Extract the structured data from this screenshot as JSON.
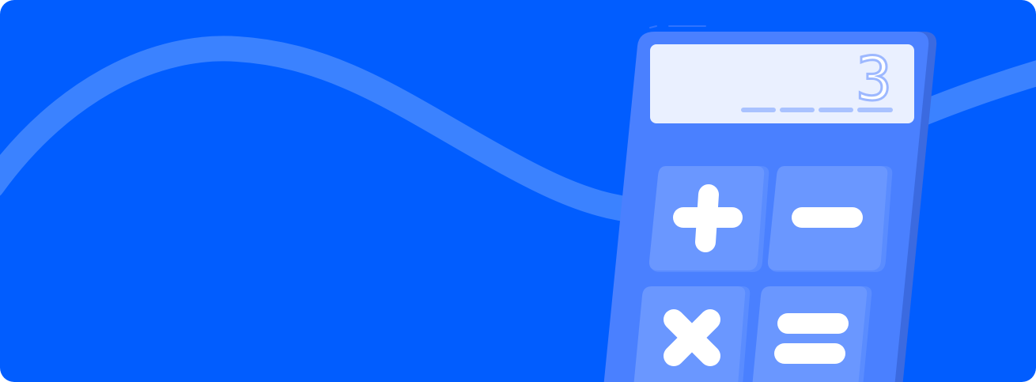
{
  "banner": {
    "background_color": "#015dff",
    "wave_color": "#3b82ff"
  },
  "calculator": {
    "display_value": "3",
    "body_color": "#4a80ff",
    "body_shadow_color": "#3b6ae0",
    "screen_color": "#eaf0ff",
    "key_color": "#6a97ff",
    "symbol_color": "#ffffff",
    "keys": [
      {
        "name": "plus-key",
        "icon": "plus-icon"
      },
      {
        "name": "minus-key",
        "icon": "minus-icon"
      },
      {
        "name": "multiply-key",
        "icon": "multiply-icon"
      },
      {
        "name": "equals-key",
        "icon": "equals-icon"
      }
    ]
  }
}
